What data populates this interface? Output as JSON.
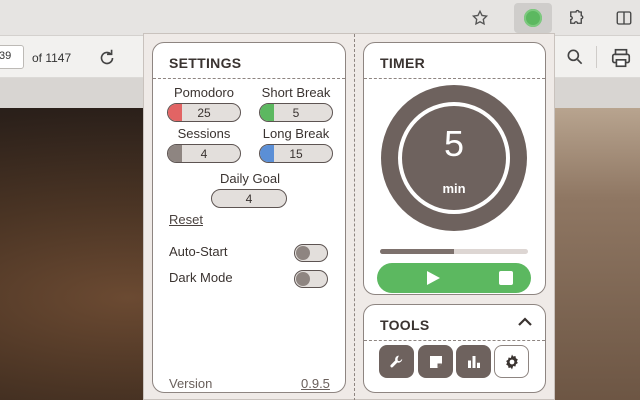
{
  "browser": {
    "page_number": "39",
    "page_total": "of 1147"
  },
  "settings": {
    "title": "SETTINGS",
    "pomodoro": {
      "label": "Pomodoro",
      "value": "25",
      "color": "#e26464"
    },
    "short_break": {
      "label": "Short Break",
      "value": "5",
      "color": "#5cb860"
    },
    "sessions": {
      "label": "Sessions",
      "value": "4",
      "color": "#8e8581"
    },
    "long_break": {
      "label": "Long Break",
      "value": "15",
      "color": "#5b8fd6"
    },
    "daily_goal": {
      "label": "Daily Goal",
      "value": "4"
    },
    "reset_label": "Reset",
    "auto_start": {
      "label": "Auto-Start",
      "on": false
    },
    "dark_mode": {
      "label": "Dark Mode",
      "on": false
    },
    "version_label": "Version",
    "version_value": "0.9.5"
  },
  "timer": {
    "title": "TIMER",
    "value": "5",
    "unit": "min",
    "progress_percent": 50,
    "play_icon": "play-icon",
    "stop_icon": "stop-icon"
  },
  "tools": {
    "title": "TOOLS",
    "buttons": [
      "wrench-icon",
      "note-icon",
      "bar-chart-icon",
      "gear-icon"
    ]
  },
  "colors": {
    "accent_green": "#5cb860",
    "dial": "#6e625e"
  }
}
